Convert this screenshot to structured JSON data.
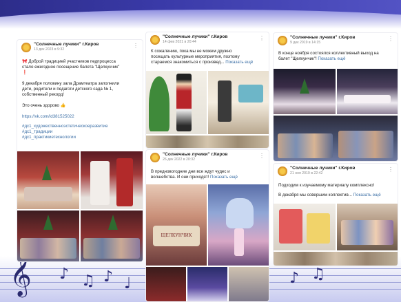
{
  "group_name": "\"Солнечные лучики\" г.Киров",
  "posts": [
    {
      "date": "13 дек 2023 в 9:32",
      "lines": [
        "🎀 Доброй традицией участников педпроцесса",
        "стало ежегодное посещение балета \"Щелкунчик\"",
        "❗"
      ],
      "paragraph2": [
        "9 декабря половину зала Драмтеатра заполнили",
        "дети, родители и педагоги детского сада № 1,",
        "собственный рекорд!"
      ],
      "paragraph3": "Это очень здорово 👍",
      "link": "https://vk.com/id381525022",
      "tags": [
        "#дс1_художественноэстетическоеразвитие",
        "#дс1_традиции",
        "#дс1_практикиетехнологии"
      ]
    },
    {
      "date": "14 фев 2021 в 20:44",
      "lines": [
        "К сожалению, пока мы не можем дружно",
        "посещать культурные мероприятия, поэтому",
        "стараемся знакомиться с произвед..."
      ],
      "more": "Показать ещё"
    },
    {
      "date": "9 дек 2019 в 14:15",
      "lines": [
        "В конце ноября состоялся коллективный выход на",
        "балет \"Щелкунчик\"!"
      ],
      "more": "Показать ещё"
    },
    {
      "date": "26 дек 2022 в 20:32",
      "lines": [
        "В предновогодние дни все ждут чудес и",
        "волшебства. И они приходят!"
      ],
      "more": "Показать ещё"
    },
    {
      "date": "21 ноя 2019 в 22:42",
      "lines": [
        "Подходим к изучаемому материалу комплексно!"
      ],
      "line2": "В декабря мы совершим коллектив...",
      "more": "Показать ещё"
    }
  ],
  "poster_text": "ЩЕЛКУНЧИК",
  "colors": {
    "banner": "#3a3aa8",
    "link": "#3a6ea5",
    "notes": "#2c2c7a"
  },
  "icons": [
    "treble-clef-icon",
    "music-note-icon",
    "more-options-icon",
    "group-logo-icon"
  ]
}
